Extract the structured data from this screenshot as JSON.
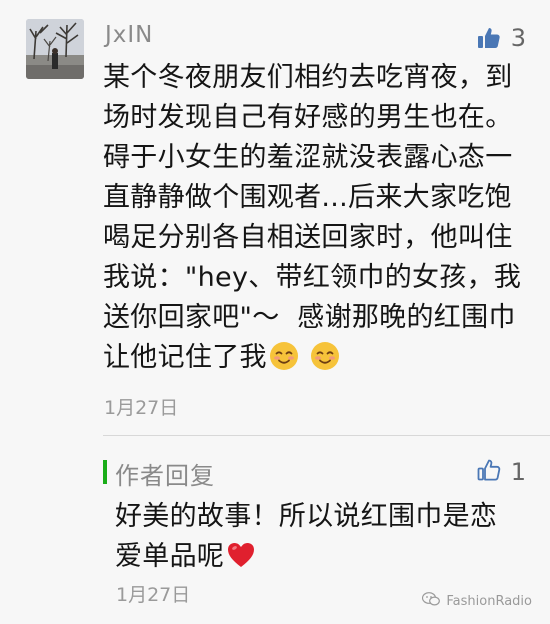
{
  "comment": {
    "username": "JxIN",
    "likes": "3",
    "text": "某个冬夜朋友们相约去吃宵夜，到\n场时发现自己有好感的男生也在。\n碍于小女生的羞涩就没表露心态一\n直静静做个围观者...后来大家吃饱\n喝足分别各自相送回家时，他叫住\n我说：\"hey、带红领巾的女孩，我\n送你回家吧\"～  感谢那晚的红围巾\n让他记住了我",
    "date": "1月27日",
    "avatar_icon": "avatar-photo",
    "like_icon": "thumbs-up-filled-icon"
  },
  "reply": {
    "label": "作者回复",
    "likes": "1",
    "text": "好美的故事！所以说红围巾是恋\n爱单品呢",
    "date": "1月27日",
    "like_icon": "thumbs-up-outline-icon"
  },
  "watermark": {
    "text": "FashionRadio"
  },
  "colors": {
    "background": "#f7f7f7",
    "accent_green": "#1aad19",
    "like_blue": "#4a77b5",
    "meta_gray": "#8a8a8a"
  }
}
